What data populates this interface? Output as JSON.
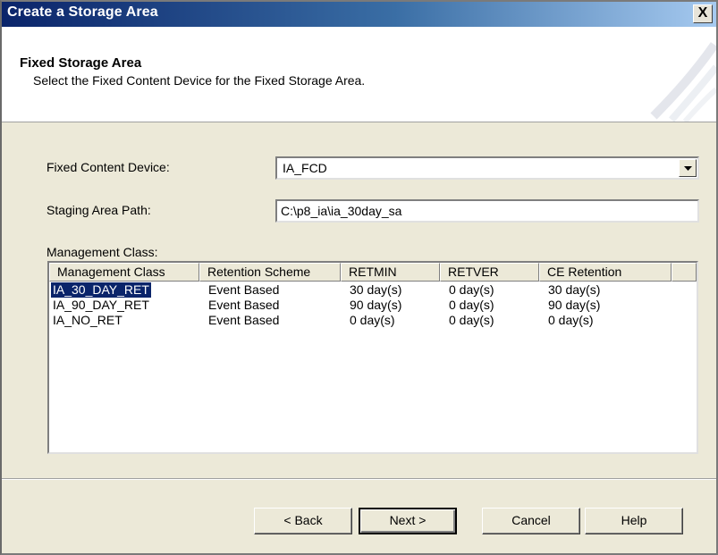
{
  "window": {
    "title": "Create a Storage Area",
    "close_label": "X"
  },
  "header": {
    "title": "Fixed Storage Area",
    "subtitle": "Select the Fixed Content Device for the Fixed Storage Area."
  },
  "form": {
    "fcd_label": "Fixed Content Device:",
    "fcd_value": "IA_FCD",
    "staging_label": "Staging Area Path:",
    "staging_value": "C:\\p8_ia\\ia_30day_sa",
    "mgmt_label": "Management Class:"
  },
  "table": {
    "columns": [
      "Management Class",
      "Retention Scheme",
      "RETMIN",
      "RETVER",
      "CE Retention"
    ],
    "rows": [
      [
        "IA_30_DAY_RET",
        "Event Based",
        "30 day(s)",
        "0 day(s)",
        "30 day(s)"
      ],
      [
        "IA_90_DAY_RET",
        "Event Based",
        "90 day(s)",
        "0 day(s)",
        "90 day(s)"
      ],
      [
        "IA_NO_RET",
        "Event Based",
        "0 day(s)",
        "0 day(s)",
        "0 day(s)"
      ]
    ],
    "selected_row": 0
  },
  "buttons": {
    "back": "< Back",
    "next": "Next >",
    "cancel": "Cancel",
    "help": "Help"
  },
  "colors": {
    "selection": "#0a246a",
    "dialog_bg": "#ece9d8",
    "title_start": "#0a246a"
  }
}
